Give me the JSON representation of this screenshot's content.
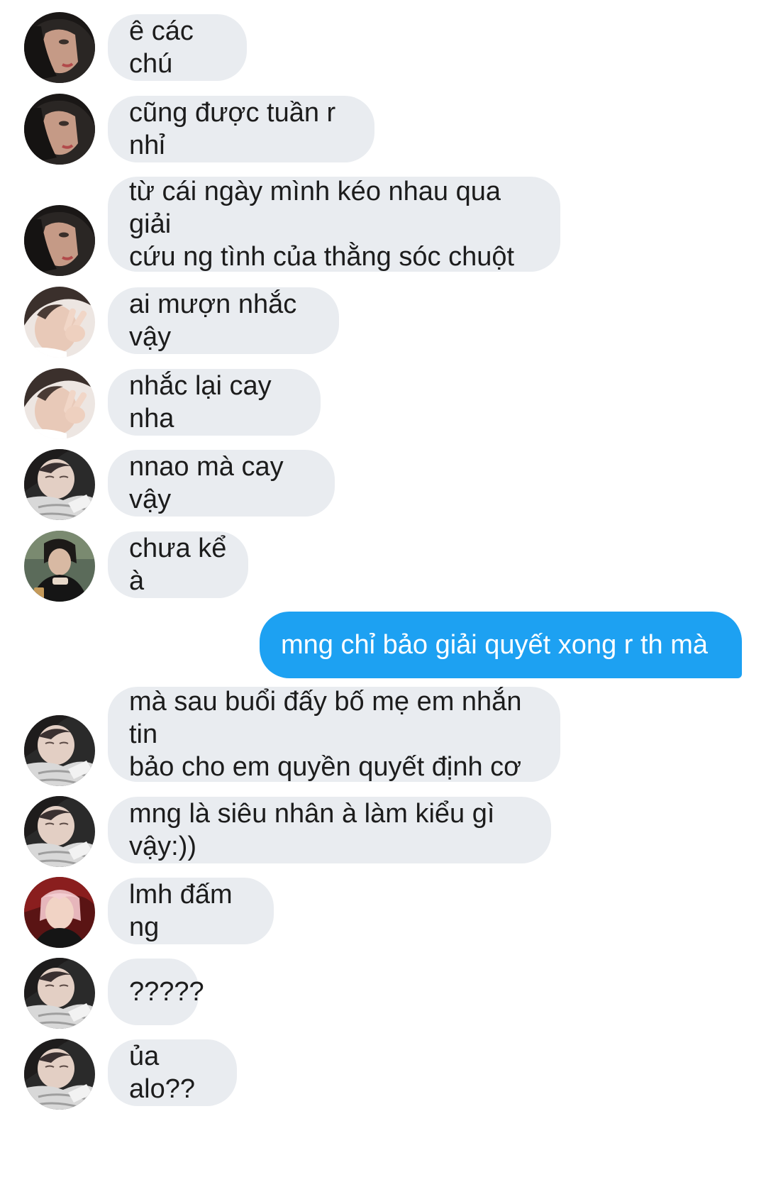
{
  "colors": {
    "incoming_bubble": "#e9ecf0",
    "outgoing_bubble": "#1da1f2",
    "incoming_text": "#1c1c1c",
    "outgoing_text": "#ffffff",
    "background": "#ffffff"
  },
  "messages": [
    {
      "direction": "incoming",
      "avatar": "avatar-hood",
      "text": "ê các chú"
    },
    {
      "direction": "incoming",
      "avatar": "avatar-hood",
      "text": "cũng được tuần r nhỉ"
    },
    {
      "direction": "incoming",
      "avatar": "avatar-hood",
      "text": "từ cái ngày mình kéo nhau qua giải\ncứu ng tình của thằng sóc chuột"
    },
    {
      "direction": "incoming",
      "avatar": "avatar-peace-sign",
      "text": "ai mượn nhắc vậy"
    },
    {
      "direction": "incoming",
      "avatar": "avatar-peace-sign",
      "text": "nhắc lại cay nha"
    },
    {
      "direction": "incoming",
      "avatar": "avatar-white-shirt",
      "text": "nnao mà cay vậy"
    },
    {
      "direction": "incoming",
      "avatar": "avatar-dark-portrait",
      "text": "chưa kể à"
    },
    {
      "direction": "outgoing",
      "avatar": null,
      "text": "mng chỉ bảo giải quyết xong r th mà"
    },
    {
      "direction": "incoming",
      "avatar": "avatar-white-shirt",
      "text": "mà sau buổi đấy bố mẹ em nhắn tin\nbảo cho em quyền quyết định cơ"
    },
    {
      "direction": "incoming",
      "avatar": "avatar-white-shirt",
      "text": "mng là siêu nhân à làm kiểu gì vậy:))"
    },
    {
      "direction": "incoming",
      "avatar": "avatar-pink-hair",
      "text": "lmh đấm ng"
    },
    {
      "direction": "incoming",
      "avatar": "avatar-white-shirt",
      "text": "?????"
    },
    {
      "direction": "incoming",
      "avatar": "avatar-white-shirt",
      "text": "ủa alo??"
    }
  ]
}
